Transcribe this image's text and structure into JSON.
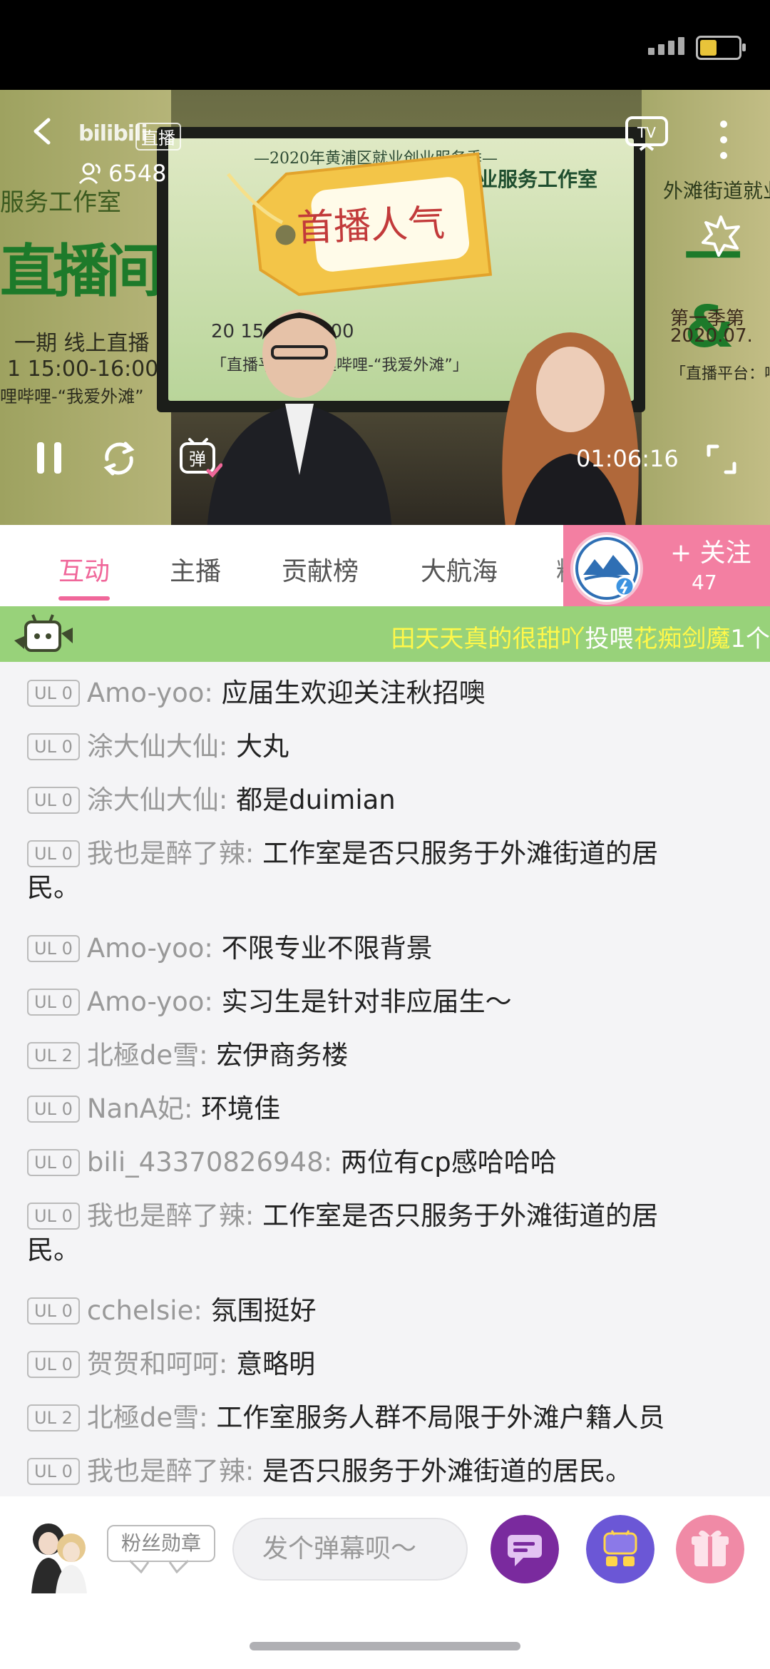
{
  "player": {
    "brand": "bilibili",
    "live_tag": "直播",
    "viewers": "6548",
    "sticker_text": "首播人气",
    "elapsed": "01:06:16",
    "screen_title": "—2020年黄浦区就业创业服务季—",
    "screen_subtitle": "街道就业服务工作室",
    "screen_time": "20 15:00-16:00",
    "screen_platform": "「直播平台：哔哩哔哩-“我爱外滩”」",
    "left_banner_line1": "服务工作室",
    "left_banner_big": "直播间",
    "left_banner_line2": "一期 线上直播",
    "left_banner_line3": "1 15:00-16:00",
    "left_banner_line4": "哩哔哩-“我爱外滩”",
    "right_banner_line1": "外滩街道就业",
    "right_banner_big": "一 &",
    "right_banner_line2": "第一季第",
    "right_banner_line3": "2020.07.",
    "right_banner_line4": "「直播平台：哔"
  },
  "tabs": [
    {
      "label": "互动",
      "active": true
    },
    {
      "label": "主播",
      "active": false
    },
    {
      "label": "贡献榜",
      "active": false
    },
    {
      "label": "大航海",
      "active": false
    },
    {
      "label": "粉",
      "active": false
    }
  ],
  "follow": {
    "label": "+ 关注",
    "count": "47"
  },
  "gift_banner": {
    "sender": "田天天真的很甜吖",
    "action": "投喂",
    "gift": "花痴剑魔",
    "count": "1个"
  },
  "chat": [
    {
      "level": "UL 0",
      "user": "Amo-yoo:",
      "text": "应届生欢迎关注秋招噢"
    },
    {
      "level": "UL 0",
      "user": "涂大仙大仙:",
      "text": "大丸"
    },
    {
      "level": "UL 0",
      "user": "涂大仙大仙:",
      "text": "都是duimian"
    },
    {
      "level": "UL 0",
      "user": "我也是醉了辣:",
      "text": "工作室是否只服务于外滩街道的居",
      "text2": "民。"
    },
    {
      "level": "UL 0",
      "user": "Amo-yoo:",
      "text": "不限专业不限背景"
    },
    {
      "level": "UL 0",
      "user": "Amo-yoo:",
      "text": "实习生是针对非应届生～"
    },
    {
      "level": "UL 2",
      "user": "北極de雪:",
      "text": "宏伊商务楼"
    },
    {
      "level": "UL 0",
      "user": "NanA妃:",
      "text": "环境佳"
    },
    {
      "level": "UL 0",
      "user": "bili_43370826948:",
      "text": "两位有cp感哈哈哈"
    },
    {
      "level": "UL 0",
      "user": "我也是醉了辣:",
      "text": "工作室是否只服务于外滩街道的居",
      "text2": "民。"
    },
    {
      "level": "UL 0",
      "user": "cchelsie:",
      "text": "氛围挺好"
    },
    {
      "level": "UL 0",
      "user": "贺贺和呵呵:",
      "text": "意略明"
    },
    {
      "level": "UL 2",
      "user": "北極de雪:",
      "text": "工作室服务人群不局限于外滩户籍人员"
    },
    {
      "level": "UL 0",
      "user": "我也是醉了辣:",
      "text": "是否只服务于外滩街道的居民。"
    }
  ],
  "bottom": {
    "fan_badge": "粉丝勋章",
    "input_placeholder": "发个弹幕呗～"
  },
  "colors": {
    "accent_pink": "#f0679a",
    "follow_bg": "#f37fa2",
    "gift_banner_bg": "#98d27a",
    "gift_name_yellow": "#fff84a",
    "chat_btn_purple": "#7a2a9e",
    "app_btn_indigo": "#6b57d6",
    "gift_btn_pink": "#f08aa6"
  },
  "icons": {
    "back": "chevron-left-icon",
    "viewers": "people-icon",
    "cast": "tv-icon",
    "more": "more-vertical-icon",
    "share": "star-burst-icon",
    "pause": "pause-icon",
    "refresh": "refresh-icon",
    "danmu": "danmu-toggle-icon",
    "fullscreen": "fullscreen-icon"
  },
  "status": {
    "battery_level": 0.45
  }
}
